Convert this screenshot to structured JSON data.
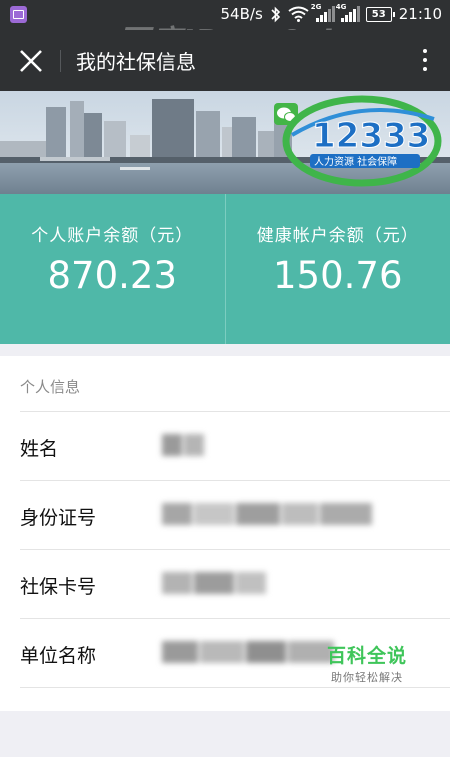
{
  "status_bar": {
    "speed": "54B/s",
    "net1": "2G",
    "net2": "4G",
    "battery": "53",
    "time": "21:10"
  },
  "watermark": "百度ID gu0zi",
  "title_bar": {
    "title": "我的社保信息"
  },
  "banner": {
    "logo_number": "12333",
    "logo_caption": "人力资源 社会保障"
  },
  "balances": [
    {
      "label": "个人账户余额（元）",
      "value": "870.23"
    },
    {
      "label": "健康帐户余额（元）",
      "value": "150.76"
    }
  ],
  "info": {
    "heading": "个人信息",
    "rows": [
      {
        "label": "姓名"
      },
      {
        "label": "身份证号"
      },
      {
        "label": "社保卡号"
      },
      {
        "label": "单位名称"
      }
    ]
  },
  "brand": {
    "name": "百科全说",
    "slogan": "助你轻松解决"
  },
  "colors": {
    "accent": "#4fb8a8",
    "bar": "#2f3133",
    "brand": "#3fc55a"
  }
}
